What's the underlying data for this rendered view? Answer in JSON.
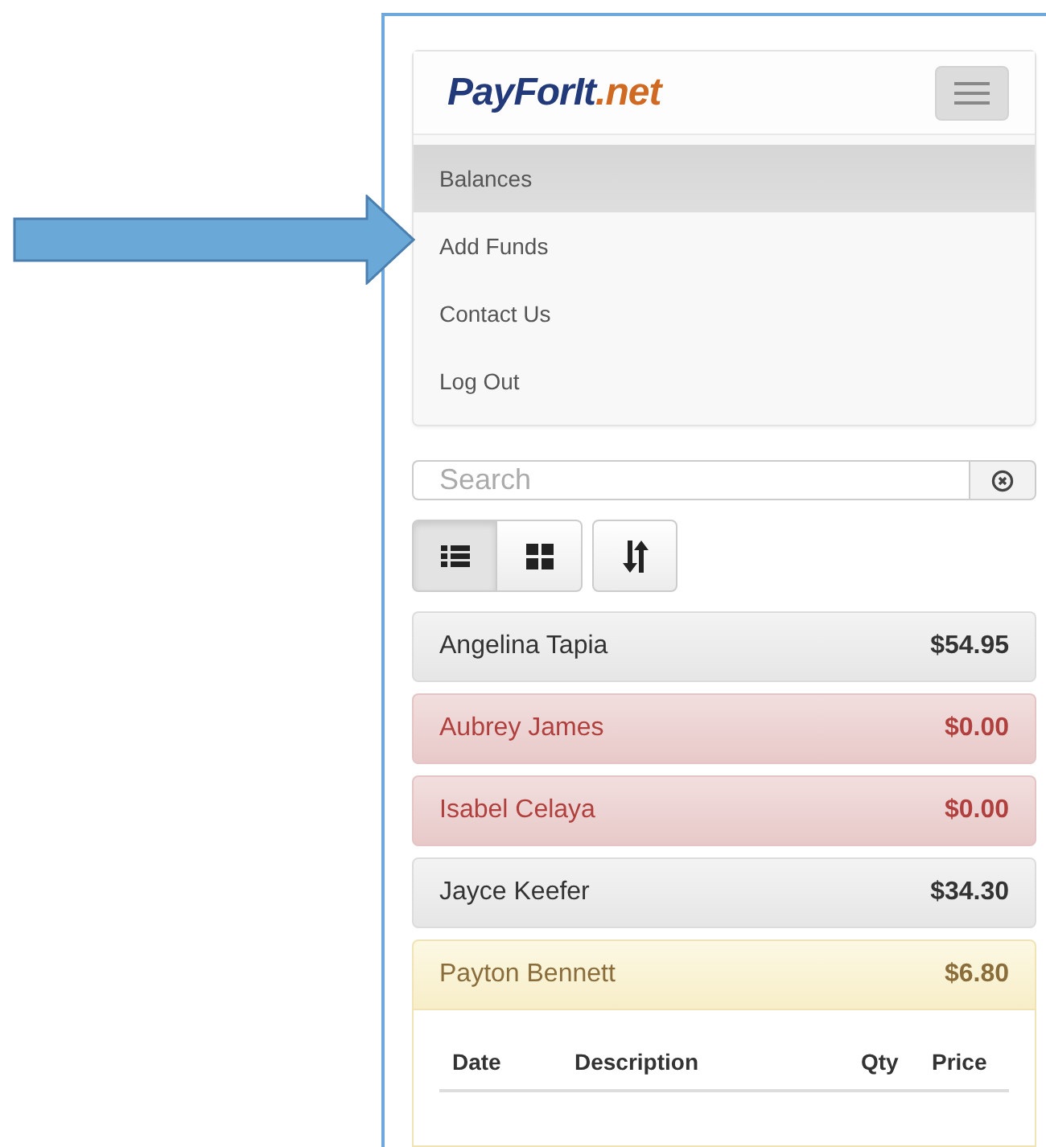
{
  "logo": {
    "name": "PayForIt",
    "domain": ".net"
  },
  "nav": {
    "items": [
      {
        "label": "Balances",
        "selected": true
      },
      {
        "label": "Add Funds",
        "selected": false
      },
      {
        "label": "Contact Us",
        "selected": false
      },
      {
        "label": "Log Out",
        "selected": false
      }
    ]
  },
  "search": {
    "placeholder": "Search"
  },
  "view_buttons": [
    {
      "kind": "list",
      "selected": true
    },
    {
      "kind": "grid",
      "selected": false
    }
  ],
  "accounts": [
    {
      "name": "Angelina Tapia",
      "balance": "$54.95",
      "kind": "default",
      "expanded": false
    },
    {
      "name": "Aubrey James",
      "balance": "$0.00",
      "kind": "danger",
      "expanded": false
    },
    {
      "name": "Isabel Celaya",
      "balance": "$0.00",
      "kind": "danger",
      "expanded": false
    },
    {
      "name": "Jayce Keefer",
      "balance": "$34.30",
      "kind": "default",
      "expanded": false
    },
    {
      "name": "Payton Bennett",
      "balance": "$6.80",
      "kind": "warning",
      "expanded": true
    }
  ],
  "transactions_table": {
    "columns": [
      "Date",
      "Description",
      "Qty",
      "Price"
    ]
  }
}
